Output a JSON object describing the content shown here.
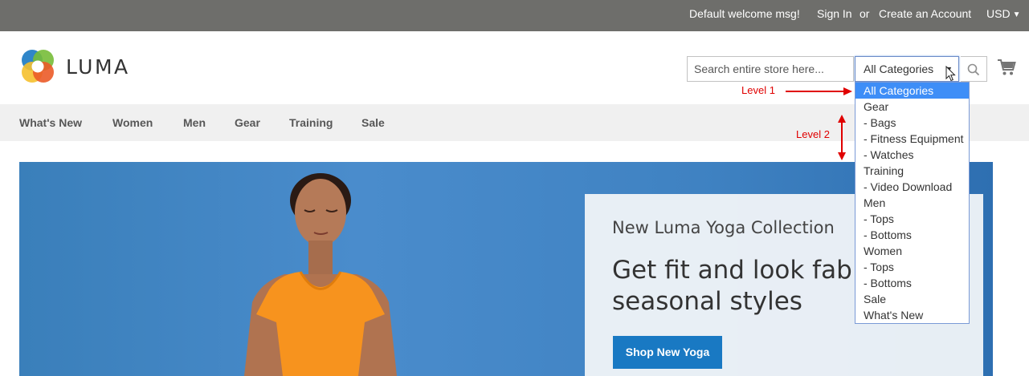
{
  "header": {
    "welcome": "Default welcome msg!",
    "sign_in": "Sign In",
    "or": "or",
    "create_account": "Create an Account",
    "currency": "USD"
  },
  "logo": {
    "text": "LUMA"
  },
  "search": {
    "placeholder": "Search entire store here...",
    "category_selected": "All Categories"
  },
  "category_dropdown": {
    "options": [
      "All Categories",
      "Gear",
      "- Bags",
      "- Fitness Equipment",
      "- Watches",
      "Training",
      "- Video Download",
      "Men",
      "- Tops",
      "- Bottoms",
      "Women",
      "- Tops",
      "- Bottoms",
      "Sale",
      "What's New"
    ],
    "selected_index": 0
  },
  "nav": {
    "items": [
      "What's New",
      "Women",
      "Men",
      "Gear",
      "Training",
      "Sale"
    ]
  },
  "annotations": {
    "level1": "Level 1",
    "level2": "Level 2",
    "color": "#e00000"
  },
  "hero": {
    "subtitle": "New Luma Yoga Collection",
    "headline": "Get fit and look fab in new\nseasonal styles",
    "cta": "Shop New Yoga"
  },
  "colors": {
    "top_bar": "#6e6e6b",
    "nav_bg": "#f0f0f0",
    "selected_option": "#3e8ef7",
    "cta_button": "#1979c3"
  },
  "icons": [
    "luma-logo-icon",
    "search-icon",
    "cart-icon",
    "chevron-down-icon",
    "mouse-cursor-icon"
  ]
}
